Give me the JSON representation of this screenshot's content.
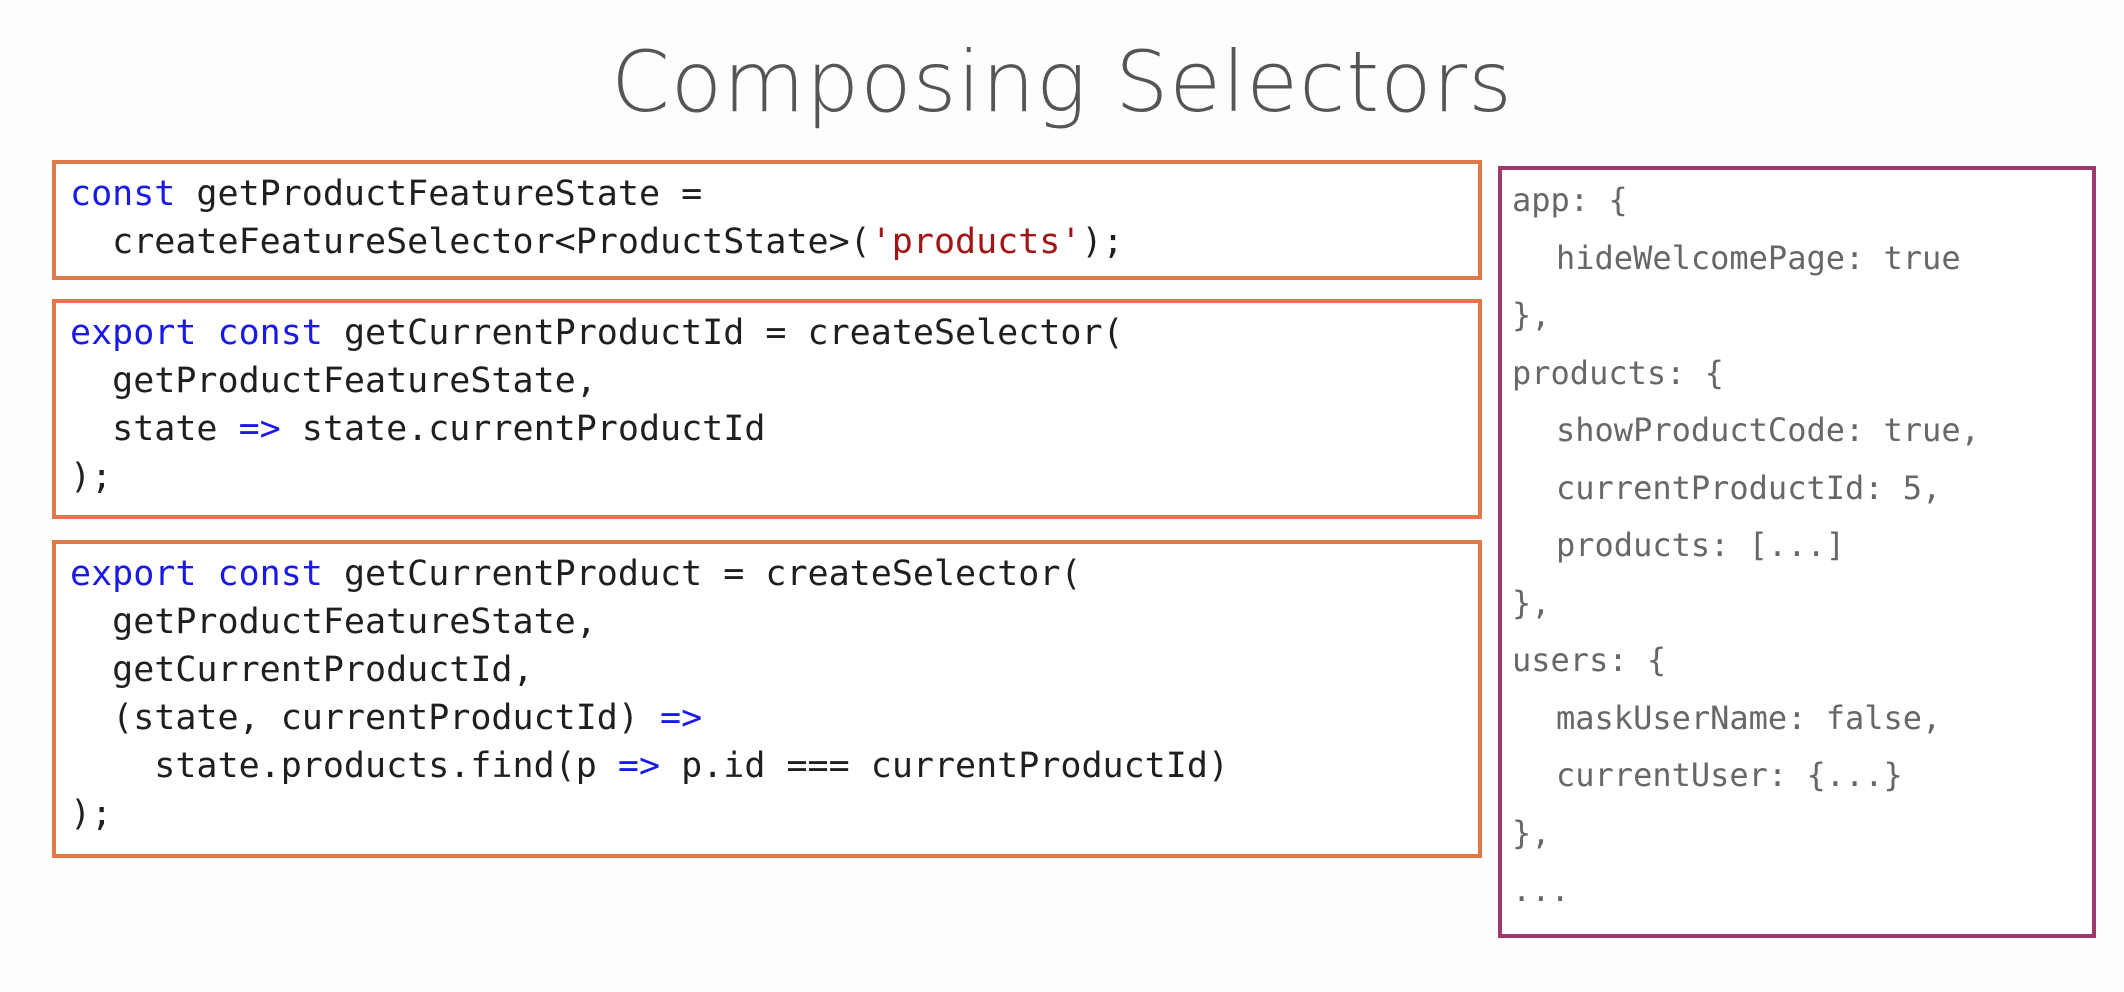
{
  "title": "Composing Selectors",
  "colors": {
    "code_box_border": "#e07848",
    "state_box_border": "#9c3a6c",
    "keyword": "#1a1ae6",
    "string": "#a31515"
  },
  "code_blocks": [
    {
      "lines": [
        [
          {
            "t": "const",
            "k": "kw"
          },
          {
            "t": " getProductFeatureState =",
            "k": "plain"
          }
        ],
        [
          {
            "t": "  createFeatureSelector<ProductState>(",
            "k": "plain"
          },
          {
            "t": "'products'",
            "k": "str"
          },
          {
            "t": ");",
            "k": "plain"
          }
        ]
      ]
    },
    {
      "lines": [
        [
          {
            "t": "export",
            "k": "kw"
          },
          {
            "t": " ",
            "k": "plain"
          },
          {
            "t": "const",
            "k": "kw"
          },
          {
            "t": " getCurrentProductId = createSelector(",
            "k": "plain"
          }
        ],
        [
          {
            "t": "  getProductFeatureState,",
            "k": "plain"
          }
        ],
        [
          {
            "t": "  state ",
            "k": "plain"
          },
          {
            "t": "=>",
            "k": "kw"
          },
          {
            "t": " state.currentProductId",
            "k": "plain"
          }
        ],
        [
          {
            "t": ");",
            "k": "plain"
          }
        ]
      ]
    },
    {
      "lines": [
        [
          {
            "t": "export",
            "k": "kw"
          },
          {
            "t": " ",
            "k": "plain"
          },
          {
            "t": "const",
            "k": "kw"
          },
          {
            "t": " getCurrentProduct = createSelector(",
            "k": "plain"
          }
        ],
        [
          {
            "t": "  getProductFeatureState,",
            "k": "plain"
          }
        ],
        [
          {
            "t": "  getCurrentProductId,",
            "k": "plain"
          }
        ],
        [
          {
            "t": "  (state, currentProductId) ",
            "k": "plain"
          },
          {
            "t": "=>",
            "k": "kw"
          }
        ],
        [
          {
            "t": "    state.products.find(p ",
            "k": "plain"
          },
          {
            "t": "=>",
            "k": "kw"
          },
          {
            "t": " p.id === currentProductId)",
            "k": "plain"
          }
        ],
        [
          {
            "t": ");",
            "k": "plain"
          }
        ]
      ]
    }
  ],
  "state_tree": {
    "lines": [
      {
        "text": "app: {",
        "indent": false
      },
      {
        "text": "hideWelcomePage: true",
        "indent": true
      },
      {
        "text": "},",
        "indent": false
      },
      {
        "text": "products: {",
        "indent": false
      },
      {
        "text": "showProductCode: true,",
        "indent": true
      },
      {
        "text": "currentProductId: 5,",
        "indent": true
      },
      {
        "text": "products: [...]",
        "indent": true
      },
      {
        "text": "},",
        "indent": false
      },
      {
        "text": "users: {",
        "indent": false
      },
      {
        "text": "maskUserName: false,",
        "indent": true
      },
      {
        "text": "currentUser: {...}",
        "indent": true
      },
      {
        "text": "},",
        "indent": false
      },
      {
        "text": "...",
        "indent": false
      }
    ]
  }
}
